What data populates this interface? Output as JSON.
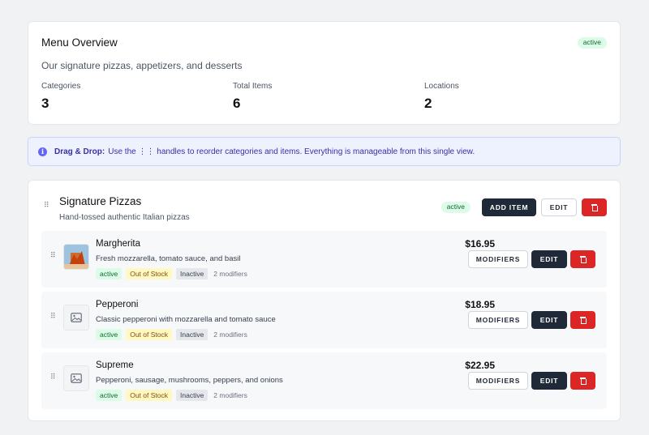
{
  "overview": {
    "title": "Menu Overview",
    "status": "active",
    "description": "Our signature pizzas, appetizers, and desserts",
    "stats": [
      {
        "label": "Categories",
        "value": "3"
      },
      {
        "label": "Total Items",
        "value": "6"
      },
      {
        "label": "Locations",
        "value": "2"
      }
    ]
  },
  "info": {
    "icon": "info-icon",
    "heading": "Drag & Drop:",
    "text": "Use the ⋮⋮ handles to reorder categories and items. Everything is manageable from this single view."
  },
  "category": {
    "title": "Signature Pizzas",
    "description": "Hand-tossed authentic Italian pizzas",
    "status": "active",
    "add_item_label": "ADD ITEM",
    "edit_label": "EDIT",
    "items": [
      {
        "name": "Margherita",
        "description": "Fresh mozzarella, tomato sauce, and basil",
        "price": "$16.95",
        "tags": [
          "active",
          "Out of Stock",
          "Inactive"
        ],
        "modifiers": "2 modifiers",
        "image": "photo",
        "modifiers_label": "MODIFIERS",
        "edit_label": "EDIT"
      },
      {
        "name": "Pepperoni",
        "description": "Classic pepperoni with mozzarella and tomato sauce",
        "price": "$18.95",
        "tags": [
          "active",
          "Out of Stock",
          "Inactive"
        ],
        "modifiers": "2 modifiers",
        "image": "placeholder",
        "modifiers_label": "MODIFIERS",
        "edit_label": "EDIT"
      },
      {
        "name": "Supreme",
        "description": "Pepperoni, sausage, mushrooms, peppers, and onions",
        "price": "$22.95",
        "tags": [
          "active",
          "Out of Stock",
          "Inactive"
        ],
        "modifiers": "2 modifiers",
        "image": "placeholder",
        "modifiers_label": "MODIFIERS",
        "edit_label": "EDIT"
      }
    ]
  },
  "colors": {
    "dark_button": "#1f2937",
    "danger": "#dc2626",
    "info_bg": "#eef2ff",
    "active_badge": "#dcfce7"
  }
}
